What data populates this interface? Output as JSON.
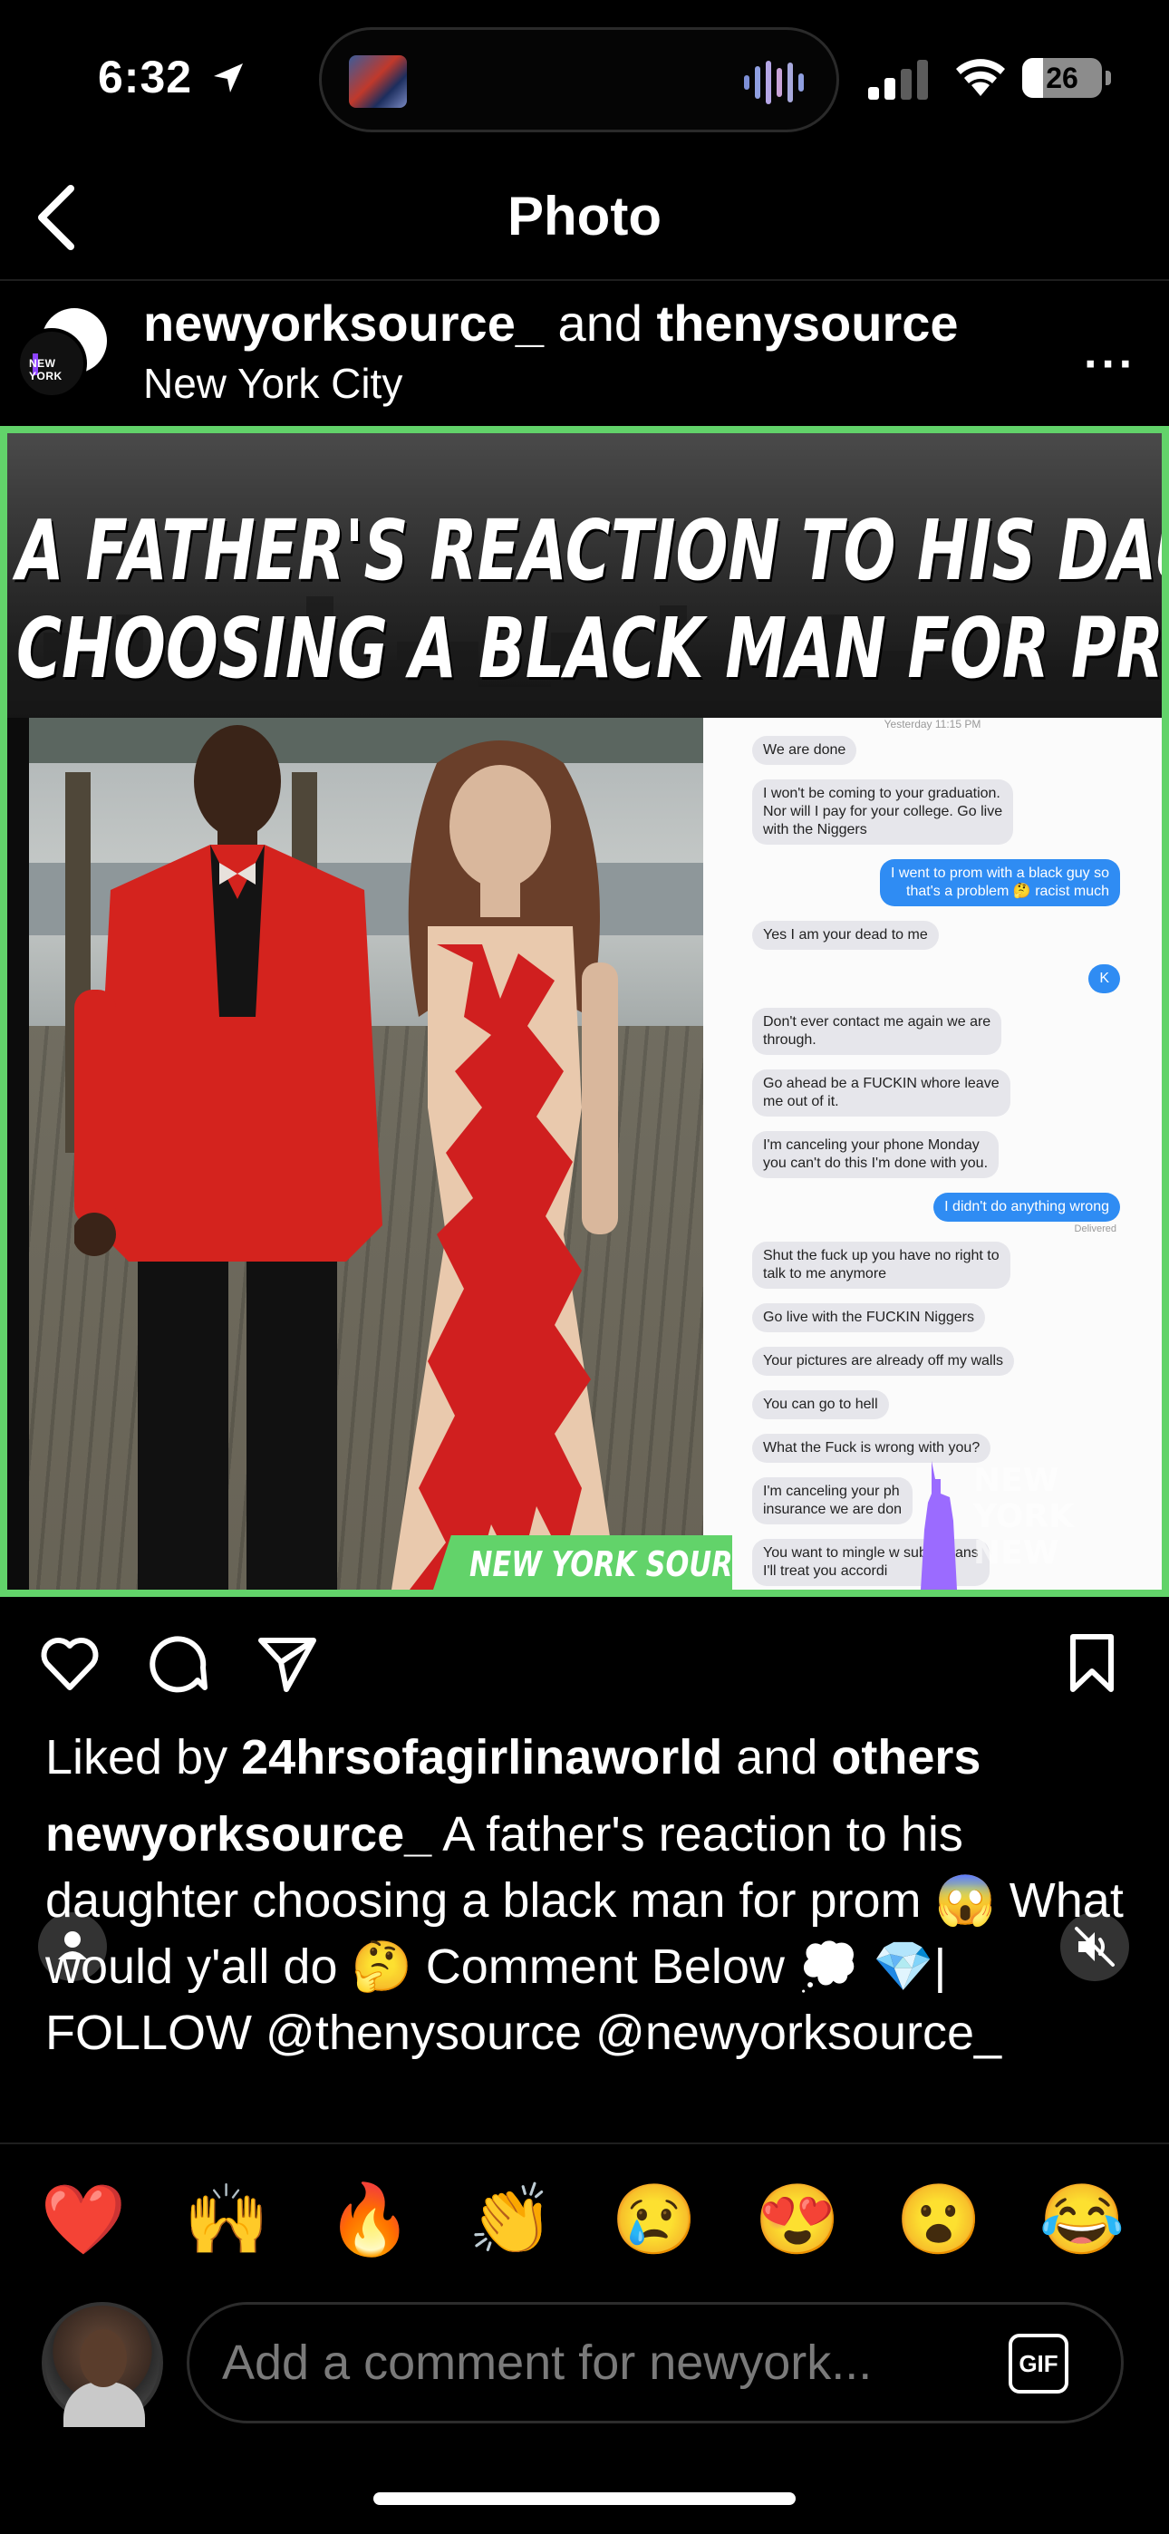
{
  "status_bar": {
    "time": "6:32",
    "battery": "26",
    "battery_level": 0.26
  },
  "nav": {
    "title": "Photo"
  },
  "post": {
    "author_primary": "newyorksource_",
    "author_joiner": " and ",
    "author_secondary": "thenysource",
    "location": "New York City",
    "more": "···",
    "avatar_text": "NEW YORK"
  },
  "image": {
    "headline_line1": "A FATHER'S REACTION TO HIS DAUGHTER",
    "headline_line2": "CHOOSING A BLACK MAN FOR PROM",
    "brand_tag": "NEW YORK SOURCE",
    "watermark_line1": "NEW YORK",
    "watermark_line2": "NEW",
    "text_thread": {
      "timestamp": "Yesterday 11:15 PM",
      "delivered": "Delivered",
      "messages": [
        {
          "side": "in",
          "text": "We are done"
        },
        {
          "side": "in",
          "text": "I won't be coming to your graduation.\nNor will I pay for your college. Go live\nwith the Niggers"
        },
        {
          "side": "out",
          "text": "I went to prom with a black guy so\nthat's a problem 🤔 racist much"
        },
        {
          "side": "in",
          "text": "Yes I am your dead to me"
        },
        {
          "side": "out",
          "text": "K"
        },
        {
          "side": "in",
          "text": "Don't ever contact me again we are\nthrough."
        },
        {
          "side": "in",
          "text": "Go ahead be a FUCKIN whore leave\nme out of it."
        },
        {
          "side": "in",
          "text": "I'm canceling your phone Monday\nyou can't do this I'm done with you."
        },
        {
          "side": "out",
          "text": "I didn't do anything wrong"
        },
        {
          "side": "in",
          "text": "Shut the fuck up you have no right to\ntalk to me anymore"
        },
        {
          "side": "in",
          "text": "Go live with the FUCKIN Niggers"
        },
        {
          "side": "in",
          "text": "Your pictures are already off my walls"
        },
        {
          "side": "in",
          "text": "You can go to hell"
        },
        {
          "side": "in",
          "text": "What the Fuck is wrong with you?"
        },
        {
          "side": "in",
          "text": "I'm canceling your ph\ninsurance we are don"
        },
        {
          "side": "in",
          "text": "You want to mingle w    subhumans\nI'll treat you accordi"
        }
      ]
    }
  },
  "engagement": {
    "liked_prefix": "Liked by ",
    "liked_user": "24hrsofagirlinaworld",
    "liked_joiner": " and ",
    "liked_others": "others"
  },
  "caption": {
    "user": "newyorksource_",
    "text": " A father's reaction to his daughter choosing a black man for prom 😱 What would y'all do 🤔 Comment Below 💭 💎| FOLLOW @thenysource @newyorksource_"
  },
  "quick_reactions": [
    "❤️",
    "🙌",
    "🔥",
    "👏",
    "😢",
    "😍",
    "😮",
    "😂"
  ],
  "comment": {
    "placeholder": "Add a comment for newyork...",
    "gif_label": "GIF"
  },
  "colors": {
    "accent_green": "#62d36a",
    "imessage_blue": "#2f8cf3",
    "background": "#000000"
  }
}
